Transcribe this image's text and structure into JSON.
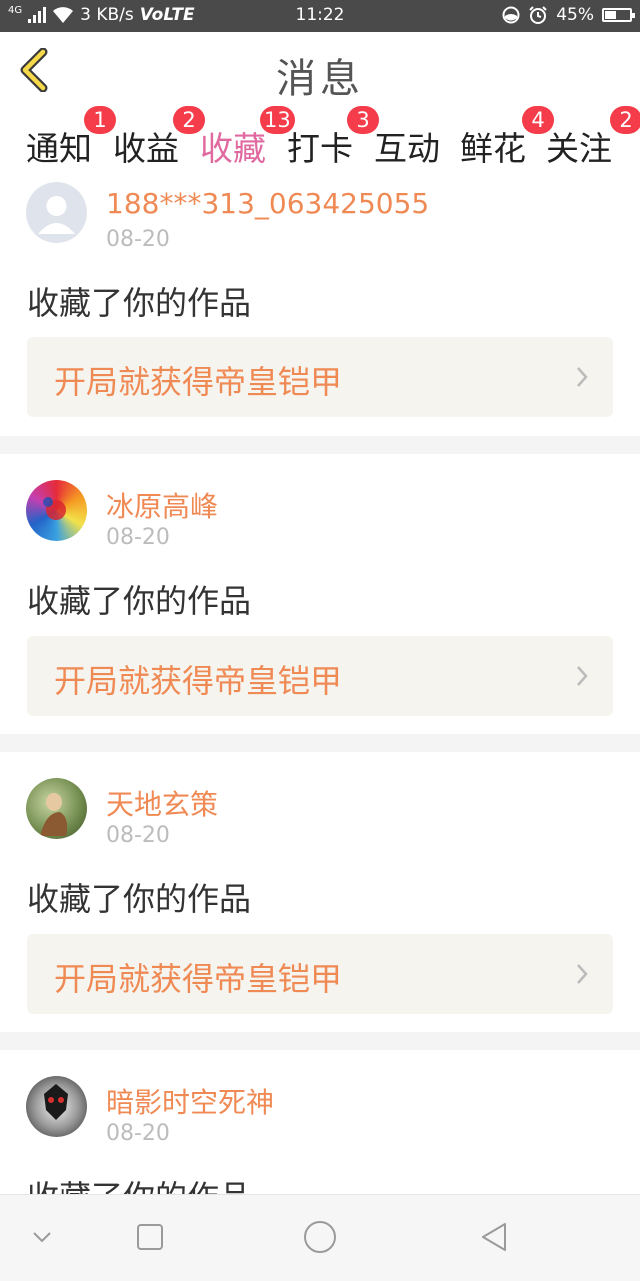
{
  "status_bar": {
    "network_type": "4G",
    "speed": "3 KB/s",
    "volte": "VoLTE",
    "time": "11:22",
    "battery_text": "45%",
    "battery_level": 0.45
  },
  "header": {
    "title": "消息",
    "back_icon": "chevron-left-icon"
  },
  "tabs": [
    {
      "label": "通知",
      "badge": "1",
      "active": false
    },
    {
      "label": "收益",
      "badge": "2",
      "active": false
    },
    {
      "label": "收藏",
      "badge": "13",
      "active": true
    },
    {
      "label": "打卡",
      "badge": "3",
      "active": false
    },
    {
      "label": "互动",
      "badge": "",
      "active": false
    },
    {
      "label": "鲜花",
      "badge": "4",
      "active": false
    },
    {
      "label": "关注",
      "badge": "2",
      "active": false
    }
  ],
  "items": [
    {
      "username": "188***313_063425055",
      "date": "08-20",
      "action": "收藏了你的作品",
      "work_title": "开局就获得帝皇铠甲",
      "avatar": "default-avatar"
    },
    {
      "username": "冰原高峰",
      "date": "08-20",
      "action": "收藏了你的作品",
      "work_title": "开局就获得帝皇铠甲",
      "avatar": "colorful-avatar"
    },
    {
      "username": "天地玄策",
      "date": "08-20",
      "action": "收藏了你的作品",
      "work_title": "开局就获得帝皇铠甲",
      "avatar": "figure-avatar"
    },
    {
      "username": "暗影时空死神",
      "date": "08-20",
      "action": "收藏了你的作品",
      "work_title": "",
      "avatar": "mask-avatar"
    }
  ],
  "colors": {
    "accent_pink": "#e06aa0",
    "username_orange": "#f08a55",
    "badge_red": "#f53c4b"
  },
  "nav_bar": {
    "icons": [
      "chevron-down-icon",
      "square-icon",
      "circle-icon",
      "triangle-back-icon"
    ]
  }
}
